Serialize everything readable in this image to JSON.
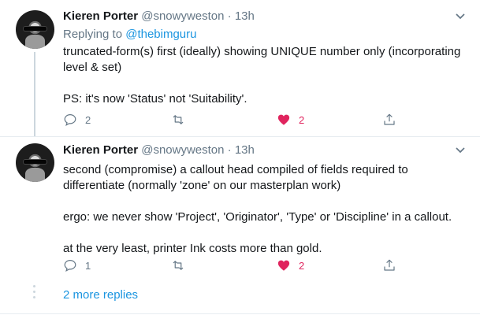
{
  "tweets": [
    {
      "name": "Kieren Porter",
      "handle": "@snowyweston",
      "dot": "·",
      "time": "13h",
      "replying_prefix": "Replying to ",
      "replying_to": "@thebimguru",
      "paragraphs": [
        "truncated-form(s) first (ideally) showing UNIQUE number only (incorporating level & set)",
        "PS: it's now 'Status' not 'Suitability'."
      ],
      "reply_count": "2",
      "retweet_count": "",
      "like_count": "2",
      "liked": true
    },
    {
      "name": "Kieren Porter",
      "handle": "@snowyweston",
      "dot": "·",
      "time": "13h",
      "paragraphs": [
        "second (compromise) a callout head compiled of fields required to differentiate (normally 'zone' on our masterplan work)",
        "ergo: we never show 'Project', 'Originator', 'Type' or 'Discipline' in a callout.",
        "at the very least, printer Ink costs more than gold."
      ],
      "reply_count": "1",
      "retweet_count": "",
      "like_count": "2",
      "liked": true
    }
  ],
  "more_replies": "2 more replies",
  "icons": {
    "reply": "reply-icon",
    "retweet": "retweet-icon",
    "like": "heart-icon",
    "share": "share-icon",
    "menu": "chevron-down-icon"
  },
  "colors": {
    "text": "#14171a",
    "muted": "#657786",
    "link": "#1b95e0",
    "like": "#e0245e",
    "divider": "#e6ecf0"
  }
}
